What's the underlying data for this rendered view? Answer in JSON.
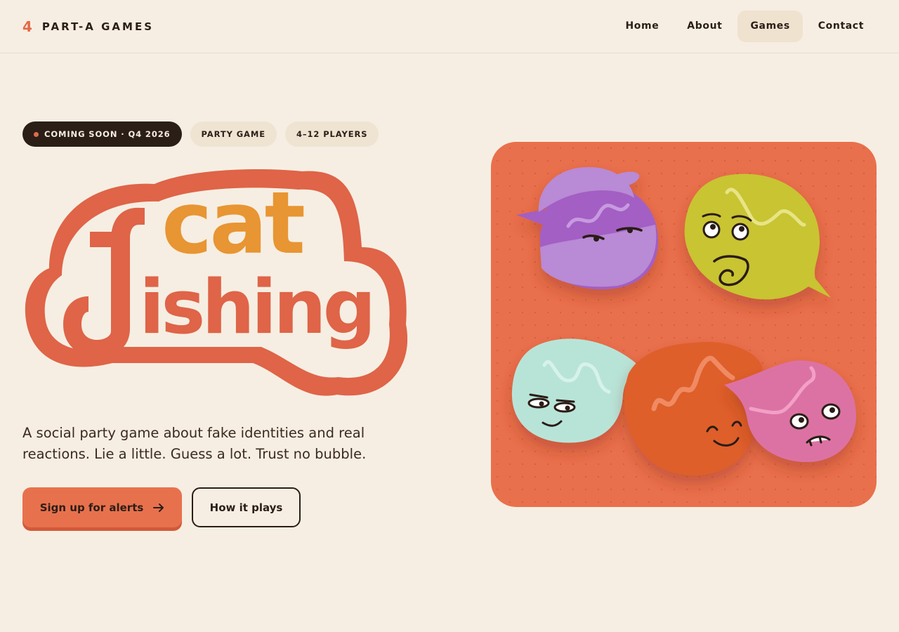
{
  "brand": {
    "mark": "4",
    "name": "PART-A GAMES"
  },
  "nav": {
    "items": [
      "Home",
      "About",
      "Games",
      "Contact"
    ],
    "active": "Games"
  },
  "hero": {
    "badges": [
      "COMING SOON · Q4 2026",
      "PARTY GAME",
      "4–12 PLAYERS"
    ],
    "logo": {
      "word_top": "cat",
      "word_bottom": "fishing"
    },
    "tagline": "A social party game about fake identities and real reactions. Lie a little. Guess a lot. Trust no bubble.",
    "cta_primary": "Sign up for alerts",
    "cta_secondary": "How it plays"
  },
  "colors": {
    "background": "#f6eee2",
    "accent": "#e8714d",
    "dark": "#2b1e17",
    "logo_red": "#df6448",
    "logo_orange": "#e89533",
    "bubble_purple": "#a667c8",
    "bubble_yellow": "#c9c433",
    "bubble_mint": "#b6e3d8",
    "bubble_orange": "#df5f2c",
    "bubble_pink": "#dc72a4"
  },
  "icons": {
    "arrow": "arrow-right-icon",
    "badge_dot": "status-dot-icon"
  }
}
